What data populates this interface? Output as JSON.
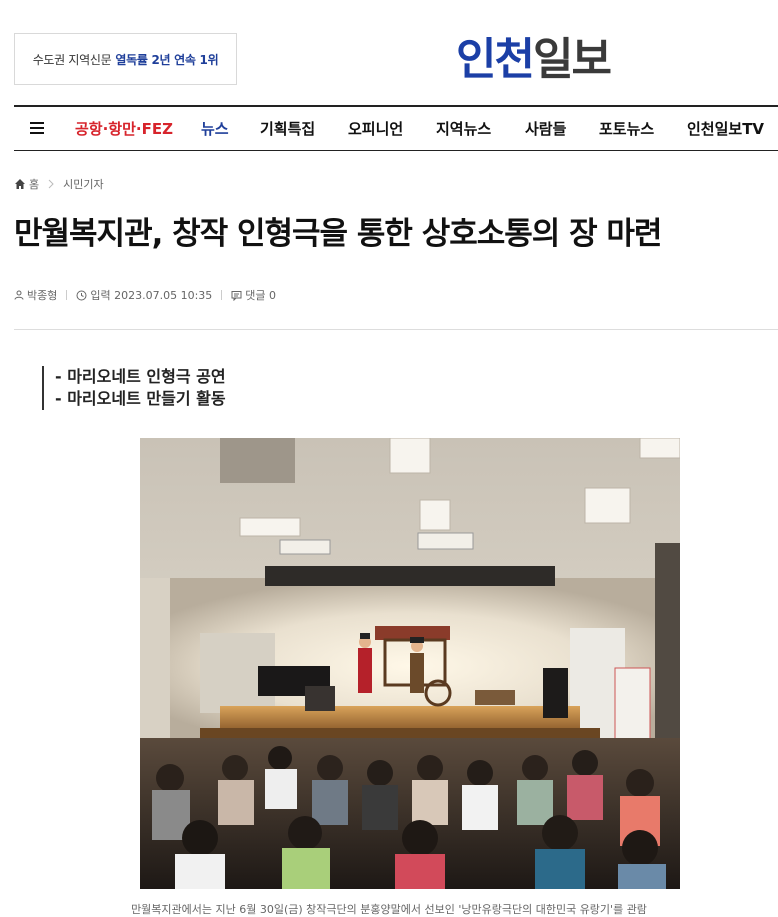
{
  "header": {
    "promo_prefix": "수도권 지역신문",
    "promo_highlight": "열독률 2년 연속 1위",
    "logo_part1": "인천",
    "logo_part2": "일보"
  },
  "nav": {
    "items": [
      "공항·항만·FEZ",
      "뉴스",
      "기획특집",
      "오피니언",
      "지역뉴스",
      "사람들",
      "포토뉴스",
      "인천일보TV"
    ]
  },
  "breadcrumb": {
    "home": "홈",
    "section": "시민기자"
  },
  "article": {
    "title": "만월복지관, 창작 인형극을 통한 상호소통의 장 마련",
    "author": "박종형",
    "date_label": "입력 2023.07.05 10:35",
    "comments_label": "댓글 0",
    "subheads": [
      "- 마리오네트 인형극 공연",
      "- 마리오네트 만들기 활동"
    ],
    "caption": "만월복지관에서는 지난 6월 30일(금) 창작극단의 분홍양말에서 선보인 '낭만유랑극단의 대한민국 유랑기'를 관람"
  },
  "colors": {
    "brand_blue": "#1b3fa6",
    "nav_red": "#d7242c"
  }
}
